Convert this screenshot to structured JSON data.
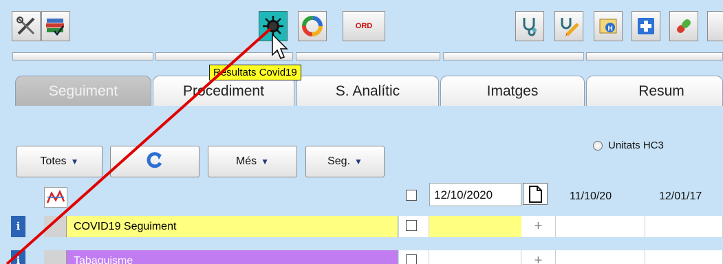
{
  "toolbar": {
    "buttons": [
      {
        "icon": "tools-icon"
      },
      {
        "icon": "books-icon"
      },
      {
        "icon": "virus-icon",
        "active": true
      },
      {
        "icon": "refresh-cycle-icon"
      },
      {
        "icon": "ord-icon",
        "label": "ORD"
      },
      {
        "icon": "stethoscope-icon"
      },
      {
        "icon": "stethoscope-pencil-icon"
      },
      {
        "icon": "hospital-icon"
      },
      {
        "icon": "medical-cross-icon"
      },
      {
        "icon": "pill-icon"
      }
    ],
    "ord_label": "ORD",
    "tooltip": "Resultats Covid19"
  },
  "tabs": [
    {
      "label": "Seguiment",
      "active": false
    },
    {
      "label": "Procediment"
    },
    {
      "label": "S. Analític"
    },
    {
      "label": "Imatges"
    },
    {
      "label": "Resum"
    }
  ],
  "filters": {
    "totes": "Totes",
    "mes": "Més",
    "seg": "Seg."
  },
  "options": {
    "unitats_label": "Unitats HC3"
  },
  "grid": {
    "date_input_value": "12/10/2020",
    "date_columns": [
      "11/10/20",
      "12/01/17"
    ],
    "rows": [
      {
        "info": "i",
        "name": "COVID19 Seguiment",
        "color": "#ffff80"
      },
      {
        "info": "i",
        "name": "Tabaquisme",
        "color": "#c27cf2"
      }
    ],
    "plus": "+"
  },
  "colors": {
    "background": "#c7e1f6",
    "active_tool": "#1fb8b8",
    "annotation_line": "#e00000",
    "tooltip": "#ffff26"
  }
}
